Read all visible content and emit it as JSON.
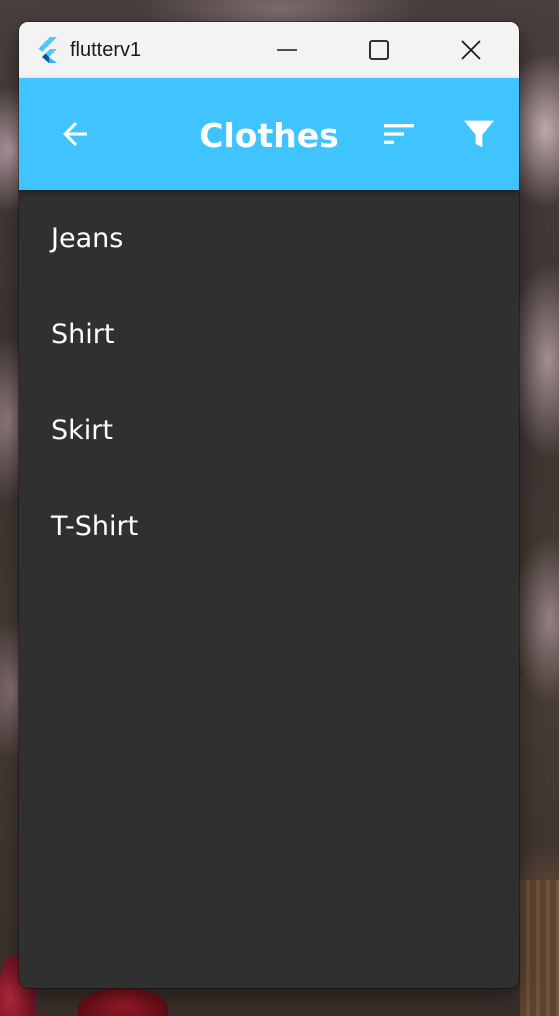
{
  "window": {
    "title": "flutterv1"
  },
  "appbar": {
    "title": "Clothes",
    "background_color": "#40c4ff",
    "back_icon": "arrow-back-icon",
    "sort_icon": "sort-icon",
    "filter_icon": "filter-icon"
  },
  "list": {
    "background_color": "#303030",
    "items": [
      {
        "label": "Jeans"
      },
      {
        "label": "Shirt"
      },
      {
        "label": "Skirt"
      },
      {
        "label": "T-Shirt"
      }
    ]
  }
}
